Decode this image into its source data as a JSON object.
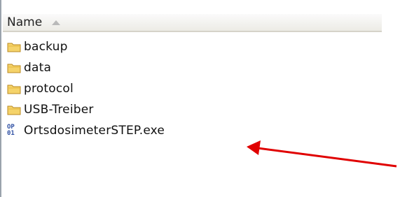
{
  "header": {
    "name_label": "Name"
  },
  "files": [
    {
      "name": "backup",
      "type": "folder",
      "icon": "folder-icon"
    },
    {
      "name": "data",
      "type": "folder",
      "icon": "folder-icon"
    },
    {
      "name": "protocol",
      "type": "folder",
      "icon": "folder-icon"
    },
    {
      "name": "USB-Treiber",
      "type": "folder",
      "icon": "folder-icon"
    },
    {
      "name": "OrtsdosimeterSTEP.exe",
      "type": "exe",
      "icon": "application-icon"
    }
  ],
  "colors": {
    "folder_fill": "#f5d36a",
    "folder_stroke": "#b98a22",
    "arrow": "#e00000",
    "exe_icon": "#2e4fa3"
  }
}
